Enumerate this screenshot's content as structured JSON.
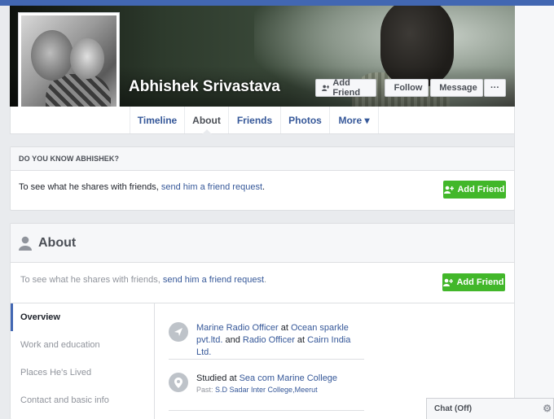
{
  "profile": {
    "name": "Abhishek Srivastava"
  },
  "cover_actions": {
    "add_friend": "Add Friend",
    "follow": "Follow",
    "message": "Message",
    "more": "···"
  },
  "nav": {
    "tabs": [
      {
        "label": "Timeline"
      },
      {
        "label": "About"
      },
      {
        "label": "Friends"
      },
      {
        "label": "Photos"
      },
      {
        "label": "More ▾"
      }
    ],
    "active": "About"
  },
  "know_card": {
    "heading": "DO YOU KNOW ABHISHEK?",
    "text_prefix": "To see what he shares with friends, ",
    "link": "send him a friend request",
    "text_suffix": ".",
    "button": "Add Friend"
  },
  "about": {
    "title": "About",
    "text_prefix": "To see what he shares with friends, ",
    "link": "send him a friend request",
    "text_suffix": ".",
    "button": "Add Friend",
    "side_nav": [
      "Overview",
      "Work and education",
      "Places He's Lived",
      "Contact and basic info"
    ],
    "work": {
      "part1_link": "Marine Radio Officer",
      "part2": " at ",
      "part3_link": "Ocean sparkle pvt.ltd.",
      "part4": " and ",
      "part5_link": "Radio Officer",
      "part6": " at ",
      "part7_link": "Cairn India Ltd."
    },
    "education": {
      "part1": "Studied at ",
      "part2_link": "Sea com Marine College",
      "past_label": "Past: ",
      "past_link": "S.D Sadar Inter College,Meerut"
    }
  },
  "chat": {
    "label": "Chat (Off)",
    "gear": "⚙"
  },
  "colors": {
    "brand": "#4267b2",
    "link": "#365899",
    "green": "#42b72a"
  }
}
